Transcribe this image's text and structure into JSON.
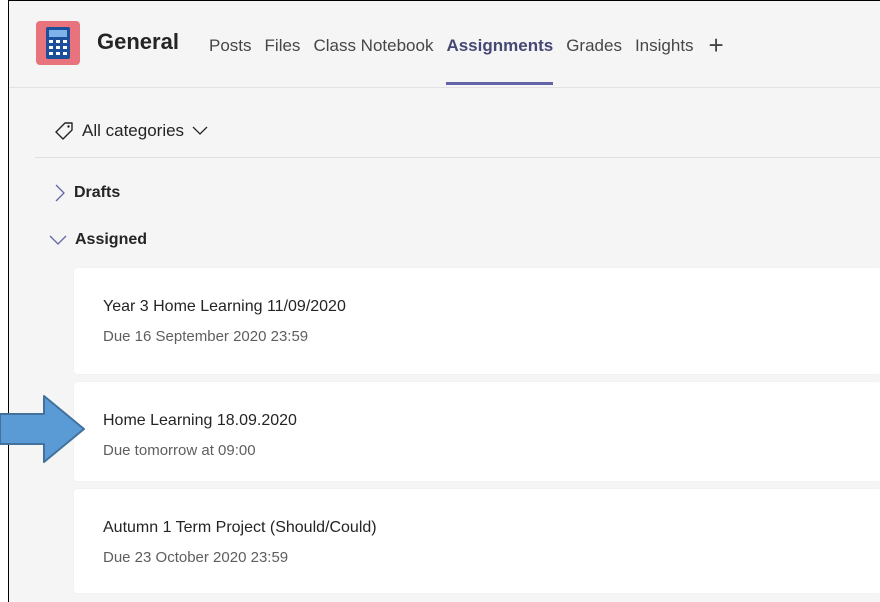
{
  "header": {
    "team_name": "General",
    "tabs": [
      {
        "label": "Posts",
        "active": false
      },
      {
        "label": "Files",
        "active": false
      },
      {
        "label": "Class Notebook",
        "active": false
      },
      {
        "label": "Assignments",
        "active": true
      },
      {
        "label": "Grades",
        "active": false
      },
      {
        "label": "Insights",
        "active": false
      }
    ],
    "add_tab_icon": "+"
  },
  "filter": {
    "label": "All categories",
    "icon": "tag-icon"
  },
  "sections": {
    "drafts": {
      "label": "Drafts",
      "expanded": false
    },
    "assigned": {
      "label": "Assigned",
      "expanded": true
    }
  },
  "assignments": [
    {
      "title": "Year 3 Home Learning 11/09/2020",
      "due": "Due 16 September 2020 23:59"
    },
    {
      "title": "Home Learning 18.09.2020",
      "due": "Due tomorrow at 09:00"
    },
    {
      "title": "Autumn 1 Term Project (Should/Could)",
      "due": "Due 23 October 2020 23:59"
    }
  ],
  "colors": {
    "accent": "#6264a7",
    "team_logo": "#e8737c",
    "arrow": "#5b9bd5"
  }
}
